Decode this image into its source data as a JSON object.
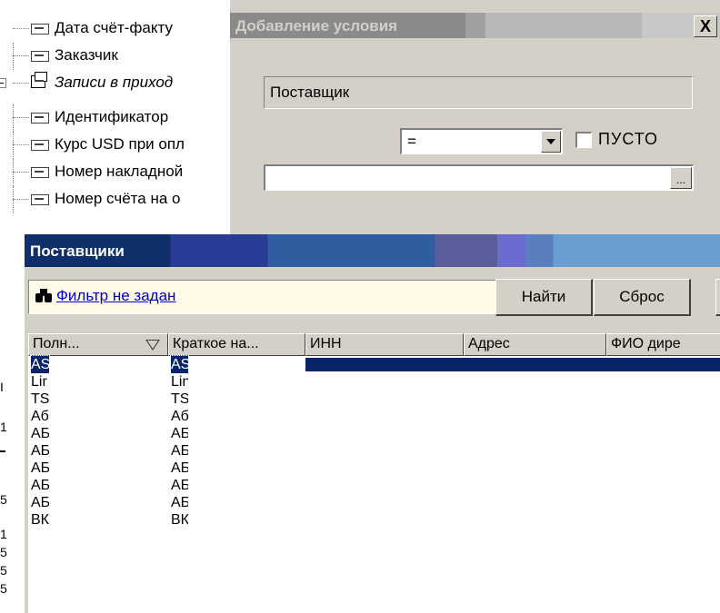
{
  "tree": {
    "items": [
      {
        "label": "Дата счёт-факту",
        "italic": false
      },
      {
        "label": "Заказчик",
        "italic": false
      },
      {
        "label": "Записи в приход",
        "italic": true
      },
      {
        "label": "Идентификатор",
        "italic": false
      },
      {
        "label": "Курс USD при опл",
        "italic": false
      },
      {
        "label": "Номер накладной",
        "italic": false
      },
      {
        "label": "Номер счёта на о",
        "italic": false
      }
    ],
    "left_fragments": [
      "I",
      "1",
      "5",
      "1",
      "5",
      "5",
      "5"
    ]
  },
  "condition_dialog": {
    "title": "Добавление условия",
    "close_label": "X",
    "field_name": "Поставщик",
    "operator": "=",
    "empty_label": "ПУСТО",
    "empty_checked": false,
    "value": "",
    "browse_label": "..."
  },
  "suppliers_window": {
    "title": "Поставщики",
    "filter_text": "Фильтр не задан",
    "find_label": "Найти",
    "reset_label": "Сброс",
    "columns": [
      "Полн...",
      "Краткое на...",
      "ИНН",
      "Адрес",
      "ФИО дире"
    ],
    "rows": [
      {
        "full": "AS",
        "short": "AS",
        "selected": true
      },
      {
        "full": "Lir",
        "short": "Lin",
        "selected": false
      },
      {
        "full": "TS",
        "short": "TS",
        "selected": false
      },
      {
        "full": "Аб",
        "short": "Аб.",
        "selected": false
      },
      {
        "full": "АБ",
        "short": "АБ",
        "selected": false
      },
      {
        "full": "АБ",
        "short": "АБ",
        "selected": false
      },
      {
        "full": "АБ",
        "short": "АБ",
        "selected": false
      },
      {
        "full": "АБ",
        "short": "АБ",
        "selected": false
      },
      {
        "full": "АБ",
        "short": "АБ",
        "selected": false
      },
      {
        "full": "ВК",
        "short": "ВК.",
        "selected": false
      }
    ]
  }
}
